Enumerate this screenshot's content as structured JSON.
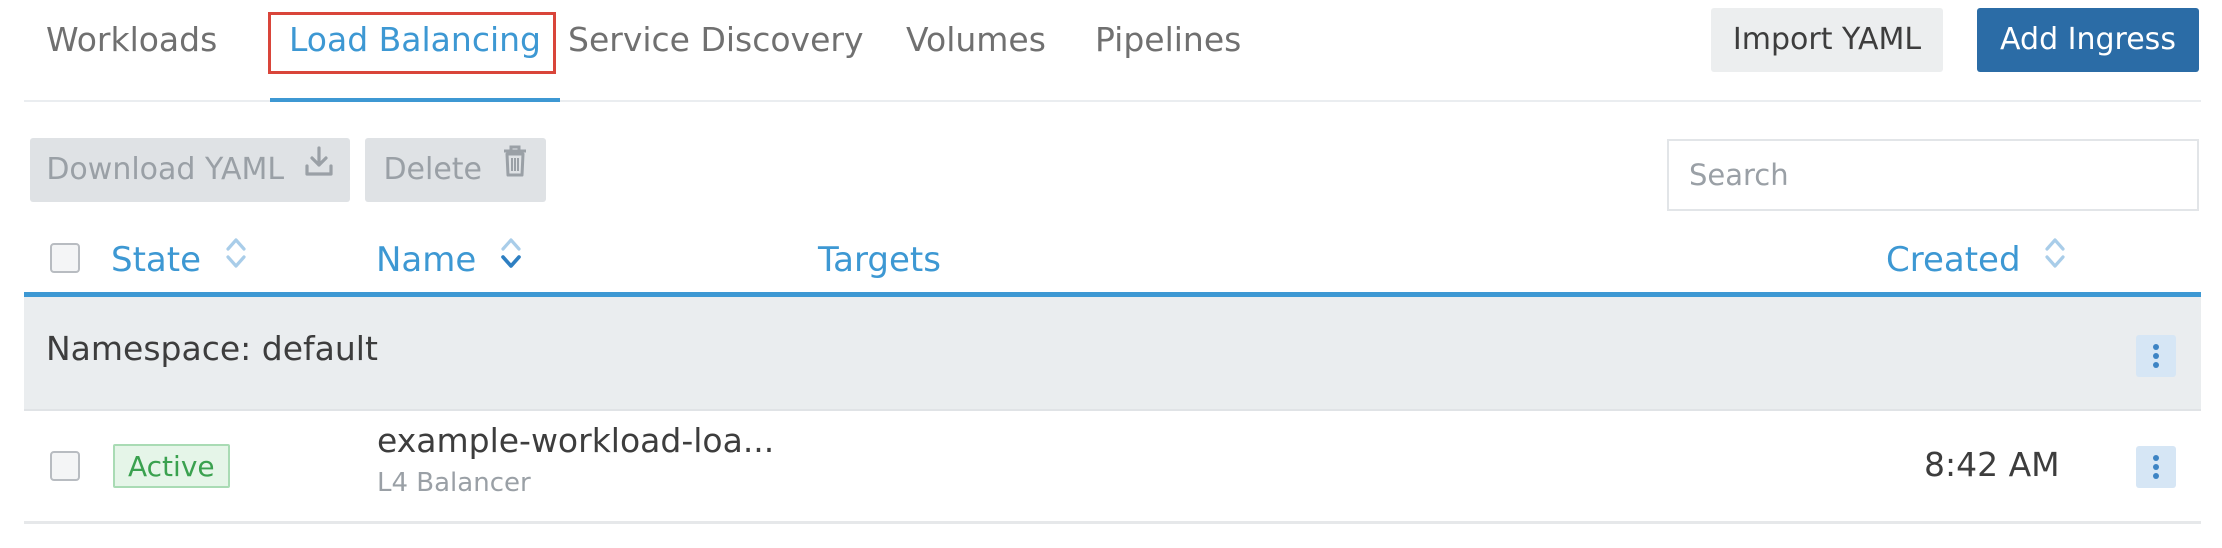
{
  "tabs": {
    "items": [
      {
        "label": "Workloads"
      },
      {
        "label": "Load Balancing",
        "active": true
      },
      {
        "label": "Service Discovery"
      },
      {
        "label": "Volumes"
      },
      {
        "label": "Pipelines"
      }
    ]
  },
  "header_actions": {
    "import_label": "Import YAML",
    "add_label": "Add Ingress"
  },
  "toolbar": {
    "download_label": "Download YAML",
    "delete_label": "Delete",
    "search_placeholder": "Search",
    "search_value": ""
  },
  "table": {
    "columns": {
      "state": "State",
      "name": "Name",
      "targets": "Targets",
      "created": "Created"
    },
    "groups": [
      {
        "label": "Namespace: default",
        "rows": [
          {
            "state": "Active",
            "name": "example-workload-loa...",
            "type": "L4 Balancer",
            "created": "8:42 AM"
          }
        ]
      }
    ]
  },
  "colors": {
    "accent": "#3d98d3",
    "primary_button": "#2b6ca6",
    "focus_outline": "#d9453a",
    "active_badge": "#3aa14f"
  },
  "icons": {
    "download": "download-icon",
    "delete": "trash-icon",
    "sort": "sort-icon",
    "row_menu": "kebab-menu-icon"
  }
}
